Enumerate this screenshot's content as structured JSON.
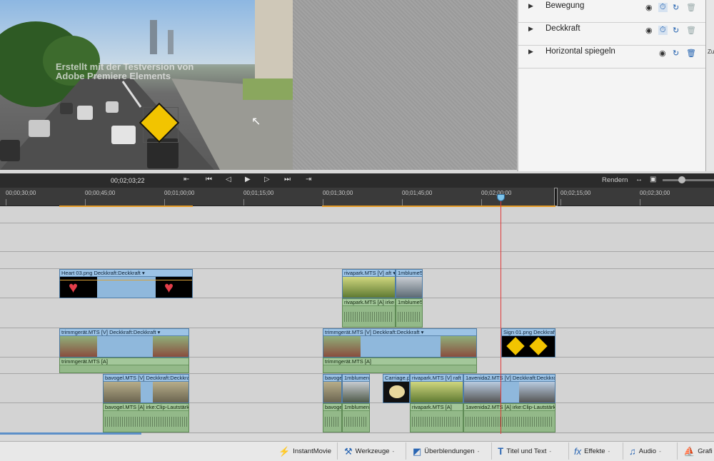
{
  "monitor": {
    "watermark_line1": "Erstellt mit der Testversion von",
    "watermark_line2": "Adobe Premiere Elements"
  },
  "properties": {
    "items": [
      {
        "label": "Bewegung"
      },
      {
        "label": "Deckkraft"
      },
      {
        "label": "Horizontal spiegeln"
      }
    ],
    "side_label": "Zu"
  },
  "transport": {
    "timecode": "00;02;03;22",
    "render_label": "Rendern"
  },
  "ruler": {
    "ticks": [
      "00;00;30;00",
      "00;00;45;00",
      "00;01;00;00",
      "00;01;15;00",
      "00;01;30;00",
      "00;01;45;00",
      "00;02;00;00",
      "00;02;15;00",
      "00;02;30;00"
    ]
  },
  "clips": {
    "heart": "Heart 03.png  Deckkraft:Deckkraft ▾",
    "rivapark_v": "rivapark.MTS [V]    aft ▾",
    "blume_v": "1mblume5",
    "rivapark_a": "rivapark.MTS [A]    irke ▾",
    "blume_a": "1mblume5",
    "trimm1_v": "trimmgerät.MTS [V]  Deckkraft:Deckkraft ▾",
    "trimm1_a": "trimmgerät.MTS [A]",
    "trimm2_v": "trimmgerät.MTS [V]  Deckkraft:Deckkraft ▾",
    "trimm2_a": "trimmgerät.MTS [A]",
    "sign": "Sign 01.png  Deckkraft ▾",
    "bavogel_v": "bavogel.MTS [V]  Deckkraft:Deckkraft ▾",
    "bavogel_a": "bavogel.MTS [A]    irke:Clip-Lautstärke ▾",
    "bavoge2_v": "bavoge",
    "bavoge2_a": "bavoge",
    "blumen_v": "1mblumen",
    "blumen_a": "1mblumen",
    "carriage": "Carriage.pn",
    "rivapark2_v": "rivapark.MTS [V]   raft ▾",
    "rivapark2_a": "rivapark.MTS [A]",
    "avenida_v": "1avenida2.MTS [V]  Deckkraft:Deckkraft ▾",
    "avenida_a": "1avenida2.MTS [A]    irke:Clip-Lautstärke ▾"
  },
  "actionbar": {
    "instantmovie": "InstantMovie",
    "werkzeuge": "Werkzeuge",
    "ueberblendungen": "Überblendungen",
    "titel": "Titel und Text",
    "effekte": "Effekte",
    "audio": "Audio",
    "grafiken": "Grafi"
  }
}
